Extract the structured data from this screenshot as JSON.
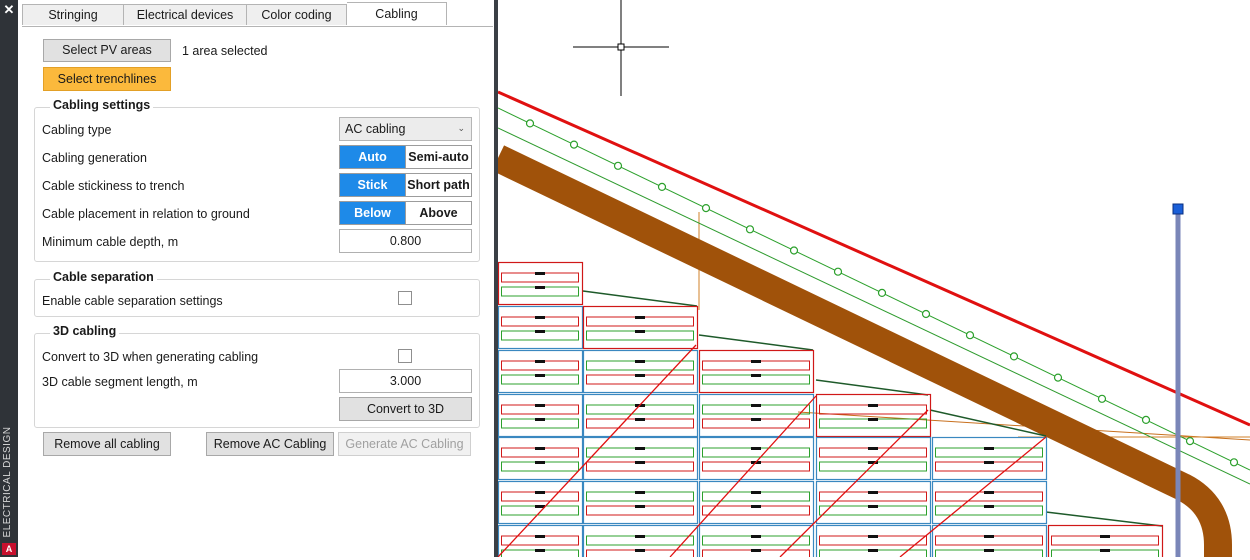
{
  "sidebar": {
    "close_glyph": "✕",
    "vertical_label": "ELECTRICAL DESIGN",
    "logo_letter": "A"
  },
  "tabs": [
    {
      "label": "Stringing",
      "active": false
    },
    {
      "label": "Electrical devices",
      "active": false
    },
    {
      "label": "Color coding",
      "active": false
    },
    {
      "label": "Cabling",
      "active": true
    }
  ],
  "top": {
    "select_pv_label": "Select PV areas",
    "selection_status": "1 area selected",
    "select_trench_label": "Select trenchlines"
  },
  "cabling_settings": {
    "title": "Cabling settings",
    "type_label": "Cabling type",
    "type_value": "AC cabling",
    "generation_label": "Cabling generation",
    "generation_options": [
      "Auto",
      "Semi-auto"
    ],
    "generation_selected": "Auto",
    "stickiness_label": "Cable stickiness to trench",
    "stickiness_options": [
      "Stick",
      "Short path"
    ],
    "stickiness_selected": "Stick",
    "placement_label": "Cable placement in relation to ground",
    "placement_options": [
      "Below",
      "Above"
    ],
    "placement_selected": "Below",
    "depth_label": "Minimum cable depth, m",
    "depth_value": "0.800"
  },
  "cable_separation": {
    "title": "Cable separation",
    "enable_label": "Enable cable separation settings",
    "enabled": false
  },
  "cabling_3d": {
    "title": "3D cabling",
    "convert_label": "Convert to 3D when generating cabling",
    "convert_checked": false,
    "segment_label": "3D cable segment length, m",
    "segment_value": "3.000",
    "convert_button": "Convert to 3D"
  },
  "actions": {
    "remove_all": "Remove all cabling",
    "remove_ac": "Remove AC Cabling",
    "generate_ac": "Generate AC Cabling"
  },
  "colors": {
    "accent": "#1e8ae8",
    "highlight": "#fbb93c",
    "trench": "#a0520a",
    "boundary": "#e01010",
    "string": "#2ca02c",
    "table_outline": "#3a88c0"
  }
}
